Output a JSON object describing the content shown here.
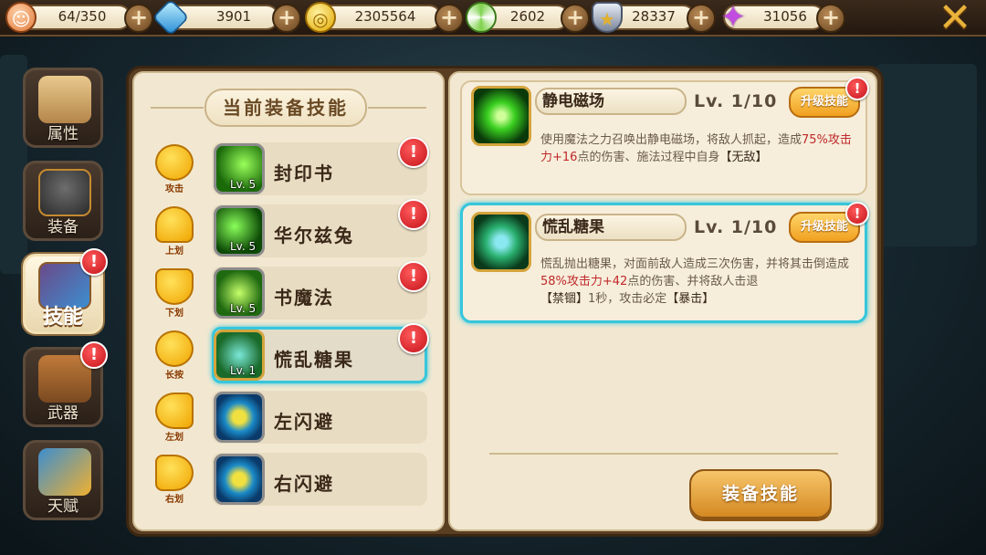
{
  "resources": [
    {
      "icon": "hero-head-icon",
      "value": "64/350",
      "color": "#f3a070"
    },
    {
      "icon": "blue-gem-icon",
      "value": "3901",
      "color": "#4fb6f2"
    },
    {
      "icon": "gold-coin-icon",
      "value": "2305564",
      "color": "#f2c021"
    },
    {
      "icon": "lollipop-icon",
      "value": "2602",
      "color": "#7ed24c"
    },
    {
      "icon": "silver-badge-icon",
      "value": "28337",
      "color": "#9aa4b6"
    },
    {
      "icon": "purple-star-icon",
      "value": "31056",
      "color": "#c24ce0"
    }
  ],
  "plus_glyph": "+",
  "close_glyph": "✕",
  "alert_glyph": "!",
  "sidebar": {
    "tabs": [
      {
        "label": "属性",
        "name": "attributes"
      },
      {
        "label": "装备",
        "name": "equipment"
      },
      {
        "label": "技能",
        "name": "skills"
      },
      {
        "label": "武器",
        "name": "weapons"
      },
      {
        "label": "天赋",
        "name": "talents"
      }
    ]
  },
  "equipped": {
    "title": "当前装备技能",
    "gestures": [
      "攻击",
      "上划",
      "下划",
      "长按",
      "左划",
      "右划"
    ],
    "slots": [
      {
        "name": "封印书",
        "level": "Lv. 5"
      },
      {
        "name": "华尔兹兔",
        "level": "Lv. 5"
      },
      {
        "name": "书魔法",
        "level": "Lv. 5"
      },
      {
        "name": "慌乱糖果",
        "level": "Lv. 1"
      },
      {
        "name": "左闪避",
        "level": ""
      },
      {
        "name": "右闪避",
        "level": ""
      }
    ]
  },
  "skills": {
    "upgrade_label": "升级技能",
    "cards": [
      {
        "name": "静电磁场",
        "level": "Lv.  1/10",
        "desc": {
          "p1": "使用魔法之力召唤出静电磁场，将敌人抓起，造成",
          "p2": "75%",
          "p3": "攻击力",
          "p4": "+16",
          "p5": "点的伤害、施法过程中自身",
          "p6": "【无敌】"
        }
      },
      {
        "name": "慌乱糖果",
        "level": "Lv.  1/10",
        "desc": {
          "p1": "慌乱抛出糖果，对面前敌人造成三次伤害，并将其击倒造成",
          "p2": "58%攻击力+42",
          "p3": "点的伤害、并将敌人击退",
          "p4": "【禁锢】",
          "p5": "1秒，攻击必定",
          "p6": "【暴击】"
        }
      }
    ]
  },
  "equip_button": "装备技能"
}
